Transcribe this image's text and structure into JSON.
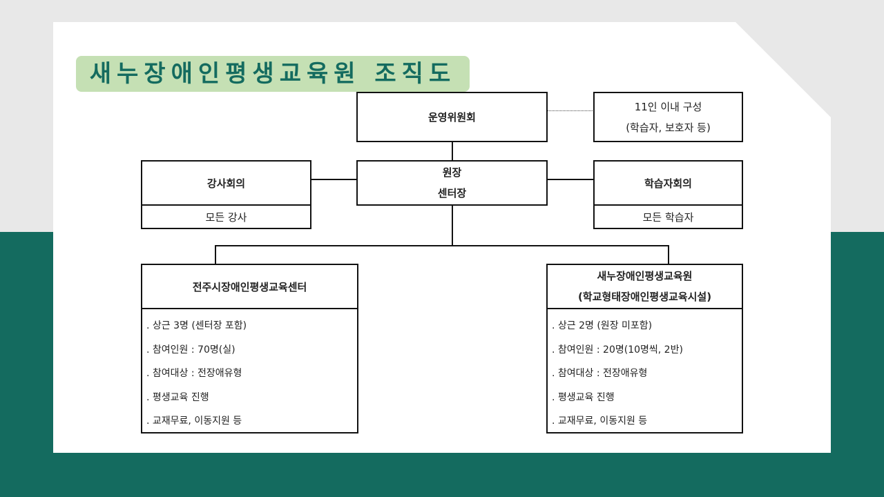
{
  "title": "새누장애인평생교육원 조직도",
  "committee": {
    "label": "운영위원회"
  },
  "committee_note": {
    "line1": "11인 이내 구성",
    "line2": "(학습자, 보호자 등)"
  },
  "director": {
    "line1": "원장",
    "line2": "센터장"
  },
  "teachers_meeting": {
    "label": "강사회의",
    "members": "모든 강사"
  },
  "learners_meeting": {
    "label": "학습자회의",
    "members": "모든 학습자"
  },
  "center_left": {
    "name": "전주시장애인평생교육센터",
    "items": [
      ". 상근 3명 (센터장 포함)",
      ". 참여인원 : 70명(실)",
      ". 참여대상 : 전장애유형",
      ". 평생교육 진행",
      ". 교재무료, 이동지원 등"
    ]
  },
  "center_right": {
    "name_line1": "새누장애인평생교육원",
    "name_line2": "(학교형태장애인평생교육시설)",
    "items": [
      ". 상근 2명 (원장 미포함)",
      ". 참여인원 : 20명(10명씩, 2반)",
      ". 참여대상 : 전장애유형",
      ". 평생교육 진행",
      ". 교재무료, 이동지원 등"
    ]
  }
}
